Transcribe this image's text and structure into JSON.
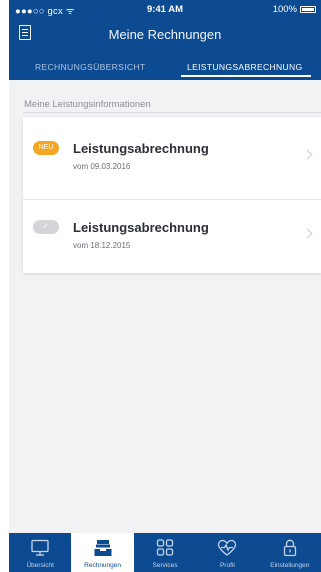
{
  "status_bar": {
    "carrier": "●●●○○ gcx ᯤ",
    "time": "9:41 AM",
    "battery": "100%"
  },
  "header": {
    "title": "Meine Rechnungen",
    "tabs": [
      {
        "label": "RECHNUNGSÜBERSICHT",
        "active": false
      },
      {
        "label": "LEISTUNGSABRECHNUNG",
        "active": true
      }
    ]
  },
  "section": {
    "label": "Meine Leistungsinformationen"
  },
  "items": [
    {
      "badge": "NEU",
      "title": "Leistungsabrechnung",
      "date": "vom 09.03.2016",
      "status": "new"
    },
    {
      "badge": "✓",
      "title": "Leistungsabrechnung",
      "date": "vom 18.12.2015",
      "status": "read"
    }
  ],
  "tabbar": [
    {
      "label": "Übersicht",
      "icon": "monitor-icon",
      "active": false
    },
    {
      "label": "Rechnungen",
      "icon": "inbox-icon",
      "active": true
    },
    {
      "label": "Services",
      "icon": "grid-icon",
      "active": false
    },
    {
      "label": "Profil",
      "icon": "heart-pulse-icon",
      "active": false
    },
    {
      "label": "Einstellungen",
      "icon": "lock-icon",
      "active": false
    }
  ],
  "colors": {
    "primary": "#0c4a92",
    "badge_new": "#f5a623",
    "badge_read": "#d3d5d9",
    "background": "#f1f2f4"
  }
}
